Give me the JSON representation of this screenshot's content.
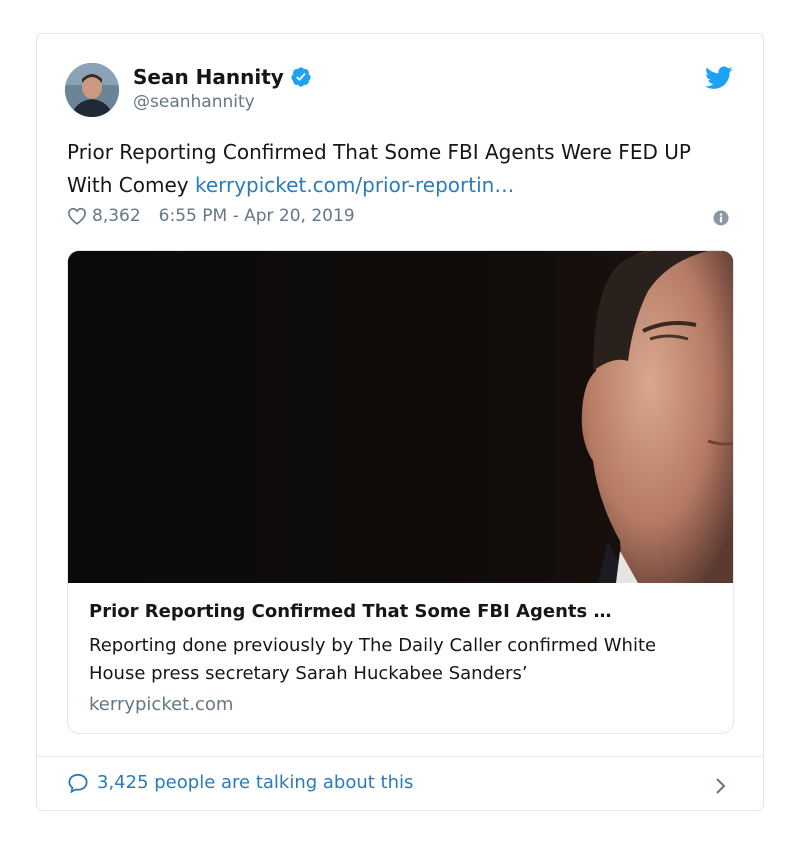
{
  "author": {
    "name": "Sean Hannity",
    "handle": "@seanhannity"
  },
  "tweet": {
    "text": "Prior Reporting Confirmed That Some FBI Agents Were FED UP With Comey",
    "link_text": "kerrypicket.com/prior-reportin…",
    "likes": "8,362",
    "timestamp": "6:55 PM - Apr 20, 2019"
  },
  "card": {
    "title": "Prior Reporting Confirmed That Some FBI Agents …",
    "description": "Reporting done previously by The Daily Caller confirmed White House press secretary Sarah Huckabee Sanders’",
    "domain": "kerrypicket.com"
  },
  "footer": {
    "talking_label": "3,425 people are talking about this"
  },
  "icons": {
    "verified": "verified-badge-icon",
    "twitter": "twitter-bird-icon",
    "like": "heart-icon",
    "info": "info-icon",
    "reply": "speech-bubble-icon",
    "chevron": "chevron-right-icon"
  },
  "colors": {
    "link": "#2b7bb9",
    "twitter_blue": "#1da1f2",
    "muted": "#657786",
    "border": "#e1e8ed"
  }
}
